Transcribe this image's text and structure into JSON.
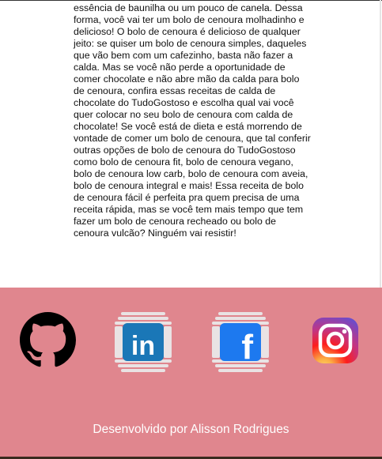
{
  "article": {
    "text": "de cenoura, você pode adicionar raspas de laranja, essência de baunilha ou um pouco de canela. Dessa forma, você vai ter um bolo de cenoura molhadinho e delicioso! O bolo de cenoura é delicioso de qualquer jeito: se quiser um bolo de cenoura simples, daqueles que vão bem com um cafezinho, basta não fazer a calda. Mas se você não perde a oportunidade de comer chocolate e não abre mão da calda para bolo de cenoura, confira essas receitas de calda de chocolate do TudoGostoso e escolha qual vai você quer colocar no seu bolo de cenoura com calda de chocolate! Se você está de dieta e está morrendo de vontade de comer um bolo de cenoura, que tal conferir outras opções de bolo de cenoura do TudoGostoso como bolo de cenoura fit, bolo de cenoura vegano, bolo de cenoura low carb, bolo de cenoura com aveia, bolo de cenoura integral e mais! Essa receita de bolo de cenoura fácil é perfeita pra quem precisa de uma receita rápida, mas se você tem mais tempo que tem fazer um bolo de cenoura recheado ou bolo de cenoura vulcão? Ninguém vai resistir!"
  },
  "footer": {
    "background": "#e0868e",
    "social": [
      {
        "icon": "github-icon"
      },
      {
        "icon": "linkedin-icon",
        "label": "in"
      },
      {
        "icon": "facebook-icon",
        "label": "f"
      },
      {
        "icon": "instagram-icon"
      }
    ],
    "credit": "Desenvolvido por Alisson Rodrigues"
  },
  "colors": {
    "linkedin": "#1a77b7",
    "facebook": "#1d79ef",
    "github": "#000000",
    "credit_text": "#ffffff"
  }
}
